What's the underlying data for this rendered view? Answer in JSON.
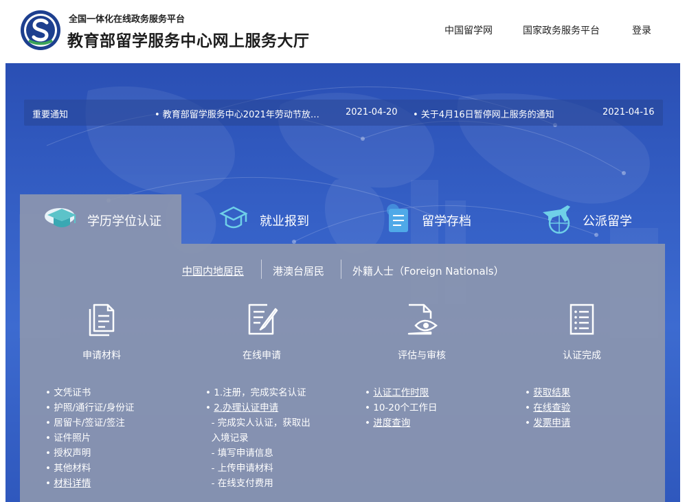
{
  "header": {
    "platform": "全国一体化在线政务服务平台",
    "title": "教育部留学服务中心网上服务大厅",
    "nav": [
      "中国留学网",
      "国家政务服务平台",
      "登录"
    ]
  },
  "notice": {
    "label": "重要通知",
    "items": [
      {
        "text": "• 教育部留学服务中心2021年劳动节放…",
        "date": "2021-04-20"
      },
      {
        "text": "• 关于4月16日暂停网上服务的通知",
        "date": "2021-04-16"
      }
    ]
  },
  "tabs": [
    {
      "label": "学历学位认证",
      "icon": "graduation-cap-icon",
      "active": true
    },
    {
      "label": "就业报到",
      "icon": "graduation-badge-icon",
      "active": false
    },
    {
      "label": "留学存档",
      "icon": "archive-document-icon",
      "active": false
    },
    {
      "label": "公派留学",
      "icon": "airplane-globe-icon",
      "active": false
    }
  ],
  "sub_tabs": [
    "中国内地居民",
    "港澳台居民",
    "外籍人士（Foreign Nationals）"
  ],
  "steps": [
    {
      "title": "申请材料",
      "icon": "documents-icon",
      "items": [
        {
          "text": "• 文凭证书",
          "link": false
        },
        {
          "text": "• 护照/通行证/身份证",
          "link": false
        },
        {
          "text": "• 居留卡/签证/签注",
          "link": false
        },
        {
          "text": "• 证件照片",
          "link": false
        },
        {
          "text": "• 授权声明",
          "link": false
        },
        {
          "text": "• 其他材料",
          "link": false
        },
        {
          "text": "• 材料详情",
          "link": true
        }
      ]
    },
    {
      "title": "在线申请",
      "icon": "edit-form-icon",
      "items": [
        {
          "text": "• 1.注册，完成实名认证",
          "link": false
        },
        {
          "text": "• 2.办理认证申请",
          "link": true
        },
        {
          "text": "  - 完成实人认证，获取出",
          "link": false
        },
        {
          "text": "  入境记录",
          "link": false
        },
        {
          "text": "  - 填写申请信息",
          "link": false
        },
        {
          "text": "  - 上传申请材料",
          "link": false
        },
        {
          "text": "  - 在线支付费用",
          "link": false
        }
      ]
    },
    {
      "title": "评估与审核",
      "icon": "review-eye-icon",
      "items": [
        {
          "text": "• 认证工作时限",
          "link": true
        },
        {
          "text": "• 10-20个工作日",
          "link": false
        },
        {
          "text": "• 进度查询",
          "link": true
        }
      ]
    },
    {
      "title": "认证完成",
      "icon": "checklist-icon",
      "items": [
        {
          "text": "• 获取结果",
          "link": true
        },
        {
          "text": "• 在线查验",
          "link": true
        },
        {
          "text": "• 发票申请",
          "link": true
        }
      ]
    }
  ]
}
